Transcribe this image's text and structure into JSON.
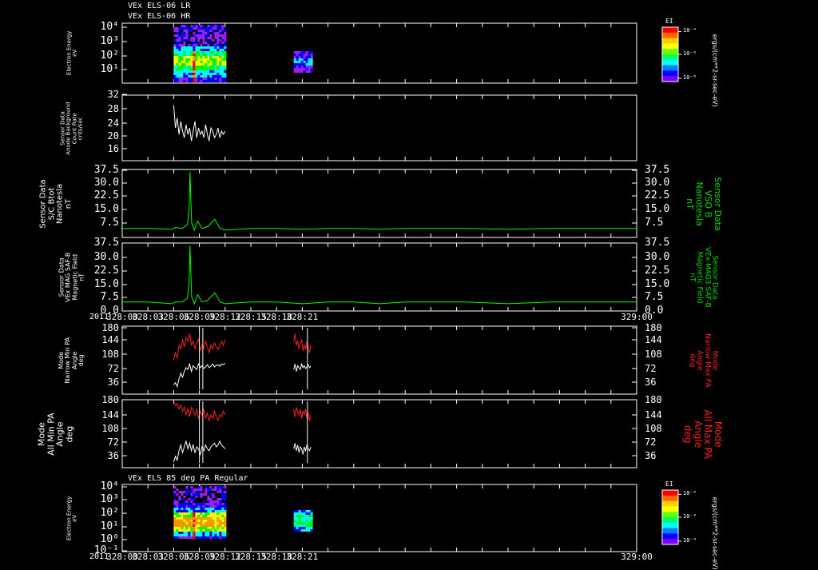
{
  "header": {
    "line1": "VEx ELS-06 LR",
    "line2": "VEx ELS-06 HR"
  },
  "mid_title": "VEx ELS 85 deg PA Regular",
  "year_label": "2011",
  "x_ticks": [
    "328:00",
    "328:03",
    "328:06",
    "328:09",
    "328:12",
    "328:15",
    "328:18",
    "328:21",
    "329:00"
  ],
  "colorbar": {
    "title": "EI",
    "label": "ergs/(cm**2-sr-sec-eV)",
    "ticks": [
      "10⁻⁴",
      "10⁻⁶",
      "10⁻⁸"
    ],
    "colors": [
      "#ff0000",
      "#ff9900",
      "#ffff00",
      "#00ff00",
      "#00ffff",
      "#0000ff",
      "#a020f0"
    ]
  },
  "panels": [
    {
      "id": "electron-energy-lr",
      "ylabel": "Electron Energy\neV",
      "y_ticks": [
        "10⁴",
        "10³",
        "10²",
        "10¹"
      ],
      "type": "spectrogram"
    },
    {
      "id": "anode-background",
      "ylabel": "Sensor Data\nAnode Background\nCount Rate\ncnts/sec",
      "y_ticks": [
        "32",
        "28",
        "24",
        "20",
        "16"
      ],
      "type": "line"
    },
    {
      "id": "sc-btot",
      "ylabel": "Sensor Data\nS/C Btot\nNanotesla\nnT",
      "right_label": "Sensor Data\nVSO B\nNanotesla\nnT",
      "y_ticks": [
        "37.5",
        "30.0",
        "22.5",
        "15.0",
        "7.5"
      ],
      "type": "line"
    },
    {
      "id": "vex-mag-saf-b",
      "ylabel": "Sensor Data\nVEx MAG SAF-B\nMagnetic Field\nnT",
      "right_label": "Sensor Data\nVEx MAG3 SAF-B\nMagnetic Field\nnT",
      "y_ticks": [
        "37.5",
        "30.0",
        "22.5",
        "15.0",
        "7.5",
        "0.0"
      ],
      "type": "line"
    },
    {
      "id": "narrow-pa",
      "ylabel": "Mode\nNarrow Min PA\nAngle\ndeg",
      "right_label": "Mode\nNarrow Max PA\nAngle\ndeg",
      "y_ticks": [
        "180",
        "144",
        "108",
        "72",
        "36"
      ],
      "type": "line"
    },
    {
      "id": "all-pa",
      "ylabel": "Mode\nAll Min PA\nAngle\ndeg",
      "right_label": "Mode\nAll Max PA\nAngle\ndeg",
      "y_ticks": [
        "180",
        "144",
        "108",
        "72",
        "36"
      ],
      "type": "line"
    },
    {
      "id": "electron-energy-85",
      "ylabel": "Electron Energy\neV",
      "y_ticks": [
        "10⁴",
        "10³",
        "10²",
        "10¹",
        "10⁰",
        "10⁻¹"
      ],
      "type": "spectrogram"
    }
  ],
  "chart_data": [
    {
      "type": "heatmap",
      "panel": "Electron Energy eV (ELS-06 LR/HR)",
      "x_range": [
        "328:00",
        "329:00"
      ],
      "y_scale": "log",
      "ylim": [
        1,
        10000
      ],
      "data_intervals": [
        [
          "328:06",
          "328:12"
        ],
        [
          "328:20",
          "328:22"
        ]
      ]
    },
    {
      "type": "line",
      "panel": "Sensor Data Anode Background Count Rate cnts/sec",
      "x_range": [
        "328:00",
        "329:00"
      ],
      "ylim": [
        12,
        32
      ],
      "series": [
        {
          "color": "#ffffff",
          "x_start": "328:06",
          "x_end": "328:12",
          "values": [
            29,
            22,
            25,
            20,
            24,
            21,
            19,
            23,
            20,
            22,
            18,
            21,
            24,
            19,
            22,
            20,
            21,
            19,
            23,
            20,
            18,
            22,
            21,
            19,
            20,
            22,
            19,
            21,
            20,
            21
          ]
        }
      ]
    },
    {
      "type": "line",
      "panel": "Sensor Data S/C Btot Nanotesla nT",
      "x_range": [
        "328:00",
        "329:00"
      ],
      "ylim": [
        0,
        37.5
      ],
      "series": [
        {
          "color": "#00ff00",
          "x": [
            0,
            3,
            5.8,
            6.2,
            7,
            7.6,
            7.8,
            7.9,
            8.1,
            8.4,
            8.8,
            9.3,
            10,
            10.8,
            11.4,
            12,
            15,
            18,
            21,
            24,
            27,
            30,
            33,
            36,
            40,
            45,
            50,
            55,
            60
          ],
          "values": [
            5,
            5,
            4.5,
            5.5,
            5,
            7,
            15,
            36,
            8,
            4,
            9,
            5,
            6,
            10,
            5,
            4,
            5,
            5,
            4.5,
            5,
            5,
            4.5,
            5,
            5,
            5,
            4.5,
            5,
            5,
            5
          ]
        }
      ]
    },
    {
      "type": "line",
      "panel": "Sensor Data VEx MAG SAF-B Magnetic Field nT",
      "x_range": [
        "328:00",
        "329:00"
      ],
      "ylim": [
        0,
        37.5
      ],
      "series": [
        {
          "color": "#00ff00",
          "x": [
            0,
            3,
            5.8,
            6.2,
            7,
            7.6,
            7.8,
            7.9,
            8.1,
            8.4,
            8.8,
            9.3,
            10,
            10.8,
            11.4,
            12,
            15,
            18,
            21,
            24,
            27,
            30,
            33,
            36,
            40,
            45,
            50,
            55,
            60
          ],
          "values": [
            5,
            5,
            4,
            5,
            5,
            7,
            15,
            36,
            8,
            4,
            9,
            5,
            6,
            10,
            5,
            4,
            5,
            5,
            4,
            5,
            5,
            4,
            5,
            5,
            5,
            4,
            5,
            5,
            5
          ]
        }
      ]
    },
    {
      "type": "line",
      "panel": "Mode Narrow Min/Max PA Angle deg",
      "x_range": [
        "328:00",
        "329:00"
      ],
      "ylim": [
        0,
        180
      ],
      "series": [
        {
          "color": "#ffffff",
          "x_start": "328:06",
          "x_end": "328:12",
          "values": [
            25,
            30,
            20,
            40,
            55,
            45,
            60,
            70,
            65,
            80,
            60,
            75,
            70,
            65,
            80,
            70,
            75,
            68,
            72,
            78,
            70,
            74,
            80,
            72,
            76,
            78,
            74,
            80,
            78,
            82
          ]
        },
        {
          "color": "#ff2020",
          "x_start": "328:06",
          "x_end": "328:12",
          "values": [
            90,
            110,
            95,
            130,
            120,
            145,
            125,
            150,
            140,
            160,
            130,
            140,
            120,
            135,
            145,
            115,
            130,
            120,
            140,
            125,
            110,
            130,
            120,
            135,
            125,
            118,
            130,
            140,
            130,
            145
          ]
        }
      ]
    },
    {
      "type": "line",
      "panel": "Mode All Min/Max PA Angle deg",
      "x_range": [
        "328:00",
        "329:00"
      ],
      "ylim": [
        0,
        180
      ],
      "series": [
        {
          "color": "#ffffff",
          "x_start": "328:06",
          "x_end": "328:12",
          "values": [
            15,
            30,
            20,
            45,
            60,
            40,
            55,
            70,
            50,
            65,
            45,
            60,
            40,
            55,
            50,
            35,
            55,
            45,
            60,
            50,
            45,
            55,
            60,
            65,
            55,
            60,
            70,
            60,
            55,
            50
          ]
        },
        {
          "color": "#ff2020",
          "x_start": "328:06",
          "x_end": "328:12",
          "values": [
            175,
            165,
            170,
            155,
            165,
            150,
            160,
            140,
            155,
            135,
            160,
            150,
            140,
            155,
            130,
            150,
            140,
            155,
            130,
            145,
            125,
            140,
            130,
            150,
            135,
            125,
            140,
            135,
            150,
            140
          ]
        }
      ]
    },
    {
      "type": "heatmap",
      "panel": "Electron Energy eV (VEx ELS 85 deg PA Regular)",
      "x_range": [
        "328:00",
        "329:00"
      ],
      "y_scale": "log",
      "ylim": [
        0.1,
        10000
      ],
      "data_intervals": [
        [
          "328:06",
          "328:12"
        ],
        [
          "328:20",
          "328:22"
        ]
      ]
    }
  ]
}
